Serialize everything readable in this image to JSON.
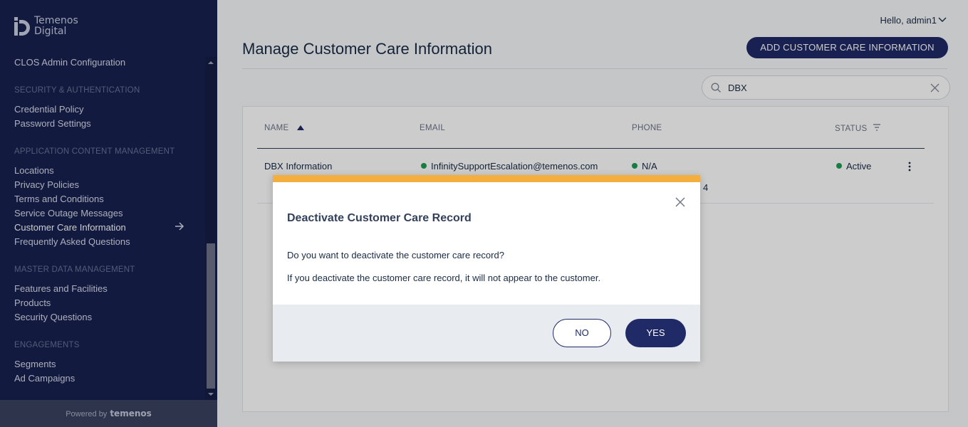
{
  "brand": {
    "line1": "Temenos",
    "line2": "Digital",
    "powered_by": "Powered by",
    "powered_brand": "temenos"
  },
  "sidebar": {
    "items": [
      {
        "type": "item",
        "label": "CLOS Admin Configuration"
      },
      {
        "type": "head",
        "label": "SECURITY & AUTHENTICATION"
      },
      {
        "type": "item",
        "label": "Credential Policy"
      },
      {
        "type": "item",
        "label": "Password Settings"
      },
      {
        "type": "head",
        "label": "APPLICATION CONTENT MANAGEMENT"
      },
      {
        "type": "item",
        "label": "Locations"
      },
      {
        "type": "item",
        "label": "Privacy Policies"
      },
      {
        "type": "item",
        "label": "Terms and Conditions"
      },
      {
        "type": "item",
        "label": "Service Outage Messages"
      },
      {
        "type": "item",
        "label": "Customer Care Information",
        "active": true
      },
      {
        "type": "item",
        "label": "Frequently Asked Questions"
      },
      {
        "type": "head",
        "label": "MASTER DATA MANAGEMENT"
      },
      {
        "type": "item",
        "label": "Features and Facilities"
      },
      {
        "type": "item",
        "label": "Products"
      },
      {
        "type": "item",
        "label": "Security Questions"
      },
      {
        "type": "head",
        "label": "ENGAGEMENTS"
      },
      {
        "type": "item",
        "label": "Segments"
      },
      {
        "type": "item",
        "label": "Ad Campaigns"
      }
    ]
  },
  "header": {
    "greeting": "Hello, admin1"
  },
  "page": {
    "title": "Manage Customer Care Information",
    "add_button": "ADD CUSTOMER CARE INFORMATION"
  },
  "search": {
    "value": "DBX"
  },
  "table": {
    "headers": {
      "name": "NAME",
      "email": "EMAIL",
      "phone": "PHONE",
      "status": "STATUS"
    },
    "row": {
      "name": "DBX Information",
      "email": "InfinitySupportEscalation@temenos.com",
      "phone": "N/A",
      "status": "Active",
      "partial": "4"
    }
  },
  "modal": {
    "title": "Deactivate Customer Care Record",
    "question": "Do you want to deactivate the customer care record?",
    "info": "If you deactivate the customer care record, it will not appear to the customer.",
    "no_label": "NO",
    "yes_label": "YES"
  },
  "colors": {
    "sidebar": "#17214f",
    "primary": "#1f2a66",
    "modal_accent": "#f3ae3d",
    "status_active": "#1f9d55"
  }
}
